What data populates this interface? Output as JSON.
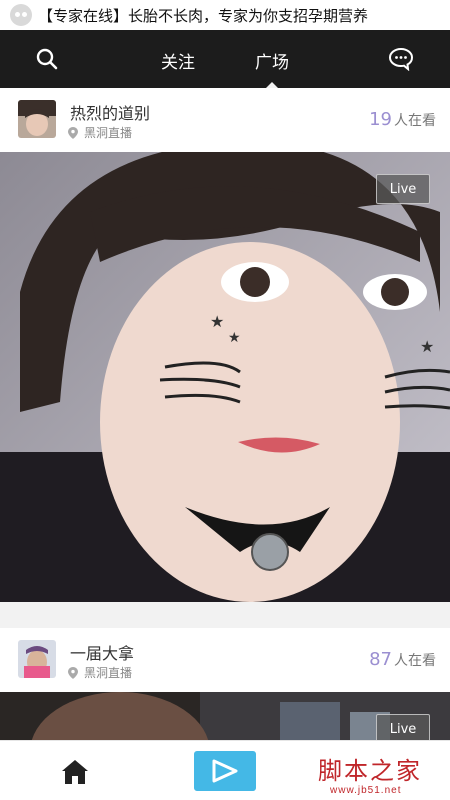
{
  "notification": {
    "text": "【专家在线】长胎不长肉，专家为你支招孕期营养",
    "app_icon": "app-logo-icon"
  },
  "header": {
    "tabs": [
      {
        "label": "关注",
        "active": false
      },
      {
        "label": "广场",
        "active": true
      }
    ],
    "left_icon": "search-icon",
    "right_icon": "message-icon",
    "background": "#1c1c1c"
  },
  "feed": [
    {
      "name": "热烈的道别",
      "location": "黑洞直播",
      "viewer_count": "19",
      "viewer_label": "人在看",
      "badge": "Live"
    },
    {
      "name": "一届大拿",
      "location": "黑洞直播",
      "viewer_count": "87",
      "viewer_label": "人在看",
      "badge": "Live"
    }
  ],
  "bottom_nav": {
    "items": [
      "home-icon",
      "play-icon"
    ],
    "accent": "#44b8e6"
  },
  "watermark": {
    "text": "脚本之家",
    "url": "www.jb51.net"
  },
  "colors": {
    "viewer_count": "#9b8fd1",
    "brand_red": "#c0262a"
  }
}
